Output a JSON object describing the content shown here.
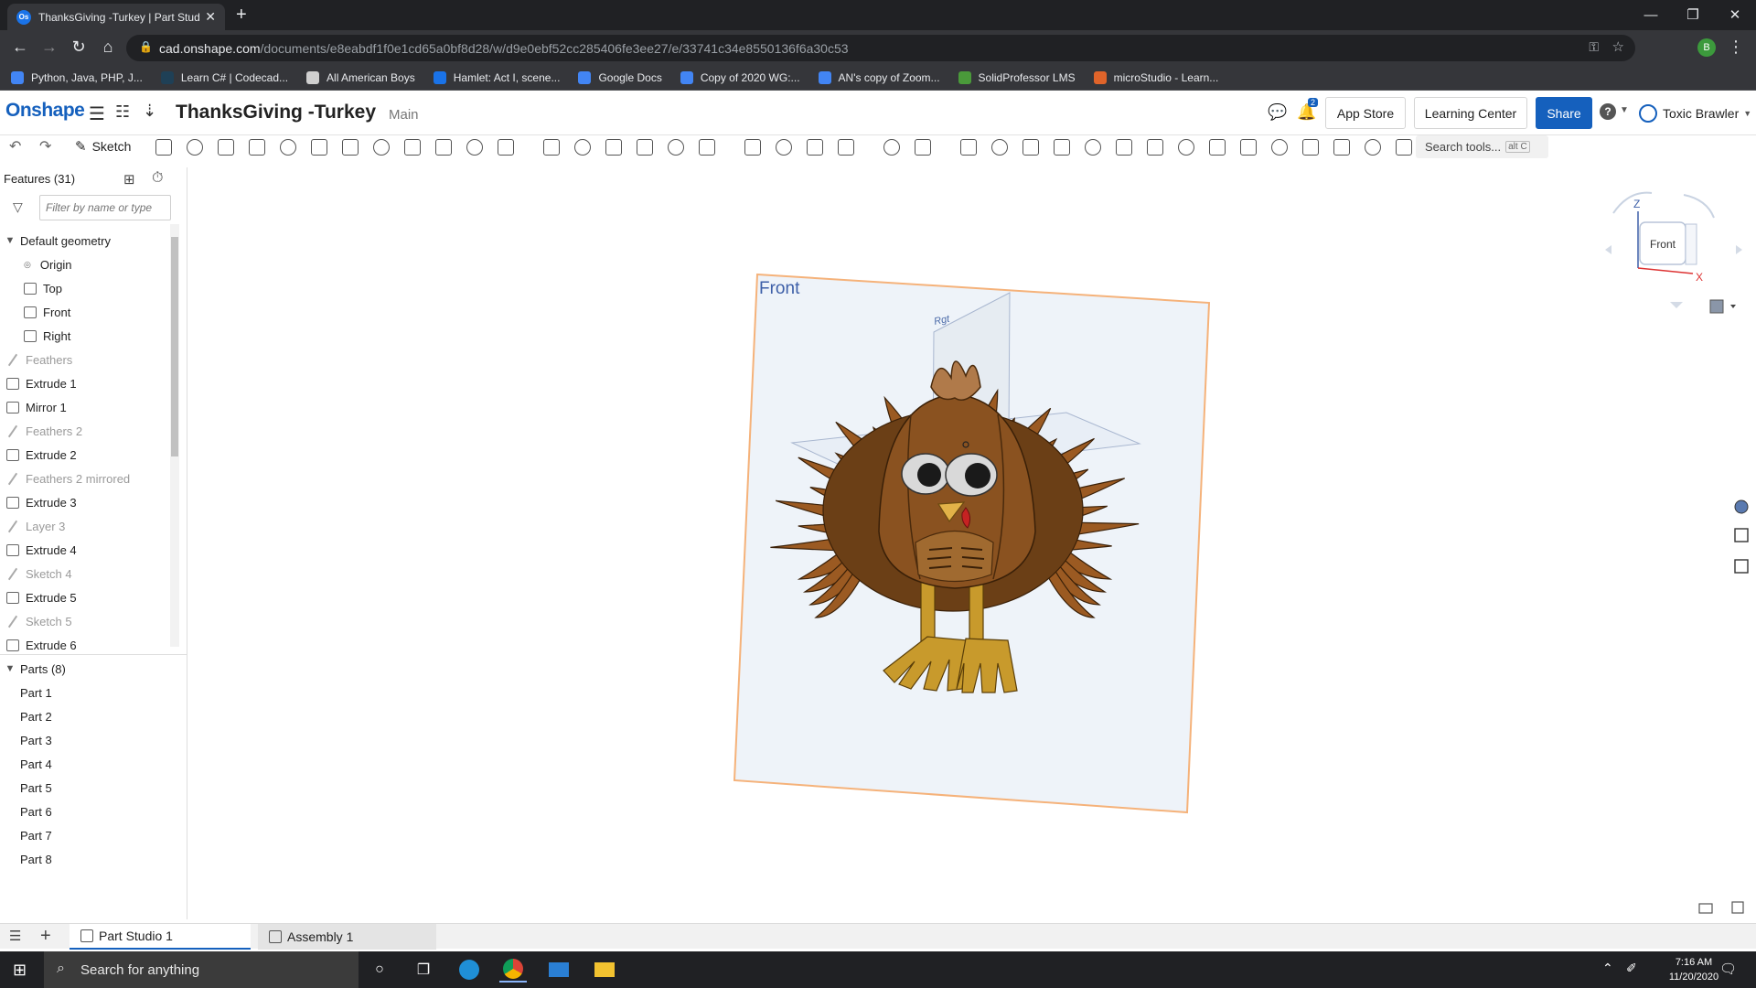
{
  "browser": {
    "tab_title": "ThanksGiving -Turkey | Part Studi",
    "tab_favicon": "Os",
    "url_host": "cad.onshape.com",
    "url_path": "/documents/e8eabdf1f0e1cd65a0bf8d28/w/d9e0ebf52cc285406fe3ee27/e/33741c34e8550136f6a30c53",
    "profile_initial": "B",
    "bookmarks": [
      {
        "label": "Python, Java, PHP, J...",
        "color": "#4285f4"
      },
      {
        "label": "Learn C# | Codecad...",
        "color": "#1f4056"
      },
      {
        "label": "All American Boys",
        "color": "#cfcfcf"
      },
      {
        "label": "Hamlet: Act I, scene...",
        "color": "#1a73e8"
      },
      {
        "label": "Google Docs",
        "color": "#4285f4"
      },
      {
        "label": "Copy of 2020 WG:...",
        "color": "#4285f4"
      },
      {
        "label": "AN's copy of Zoom...",
        "color": "#4285f4"
      },
      {
        "label": "SolidProfessor LMS",
        "color": "#4a9a3a"
      },
      {
        "label": "microStudio - Learn...",
        "color": "#e0642a"
      }
    ]
  },
  "header": {
    "logo": "Onshape",
    "document_title": "ThanksGiving -Turkey",
    "workspace": "Main",
    "notification_count": "2",
    "app_store": "App Store",
    "learning_center": "Learning Center",
    "share": "Share",
    "help_icon": "?",
    "user_name": "Toxic Brawler"
  },
  "toolbar": {
    "sketch_label": "Sketch",
    "search_placeholder": "Search tools...",
    "search_shortcut": "alt C"
  },
  "feature_panel": {
    "title": "Features (31)",
    "filter_placeholder": "Filter by name or type",
    "default_geometry_label": "Default geometry",
    "default_geometry": [
      "Origin",
      "Top",
      "Front",
      "Right"
    ],
    "features": [
      {
        "label": "Feathers",
        "kind": "sketch",
        "suppressed": true
      },
      {
        "label": "Extrude 1",
        "kind": "extrude",
        "suppressed": false
      },
      {
        "label": "Mirror 1",
        "kind": "mirror",
        "suppressed": false
      },
      {
        "label": "Feathers 2",
        "kind": "sketch",
        "suppressed": true
      },
      {
        "label": "Extrude 2",
        "kind": "extrude",
        "suppressed": false
      },
      {
        "label": "Feathers 2 mirrored",
        "kind": "sketch",
        "suppressed": true
      },
      {
        "label": "Extrude 3",
        "kind": "extrude",
        "suppressed": false
      },
      {
        "label": "Layer 3",
        "kind": "sketch",
        "suppressed": true
      },
      {
        "label": "Extrude 4",
        "kind": "extrude",
        "suppressed": false
      },
      {
        "label": "Sketch 4",
        "kind": "sketch",
        "suppressed": true
      },
      {
        "label": "Extrude 5",
        "kind": "extrude",
        "suppressed": false
      },
      {
        "label": "Sketch 5",
        "kind": "sketch",
        "suppressed": true
      },
      {
        "label": "Extrude 6",
        "kind": "extrude",
        "suppressed": false
      }
    ],
    "parts_label": "Parts (8)",
    "parts": [
      "Part 1",
      "Part 2",
      "Part 3",
      "Part 4",
      "Part 5",
      "Part 6",
      "Part 7",
      "Part 8"
    ]
  },
  "viewport": {
    "plane_label": "Front",
    "right_plane_label": "Rgt",
    "view_cube_face": "Front",
    "axis_z": "Z",
    "axis_x": "X",
    "colors": {
      "plane_border": "#f5b27a",
      "plane_fill": "#eef3f9",
      "feather_dark": "#6b3f16",
      "feather": "#9b5a22",
      "body": "#8a5220",
      "legs": "#c89a2c"
    }
  },
  "bottom_tabs": {
    "part_studio": "Part Studio 1",
    "assembly": "Assembly 1"
  },
  "taskbar": {
    "search_text": "Search for anything",
    "time": "7:16 AM",
    "date": "11/20/2020"
  }
}
